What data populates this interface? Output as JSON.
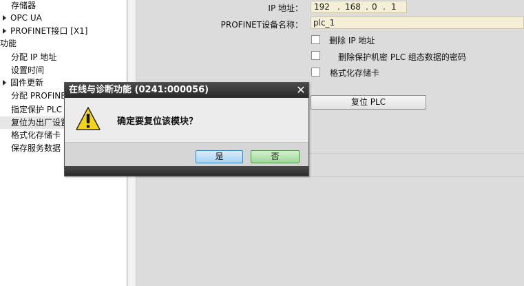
{
  "nav": {
    "items": [
      {
        "label": "存储器"
      },
      {
        "label": "OPC UA"
      },
      {
        "label": "PROFINET接口 [X1]"
      },
      {
        "label": "功能"
      },
      {
        "label": "分配 IP 地址"
      },
      {
        "label": "设置时间"
      },
      {
        "label": "固件更新"
      },
      {
        "label": "分配 PROFINET"
      },
      {
        "label": "指定保护 PLC 组"
      },
      {
        "label": "复位为出厂设置"
      },
      {
        "label": "格式化存储卡"
      },
      {
        "label": "保存服务数据"
      }
    ]
  },
  "form": {
    "ip_label": "IP 地址：",
    "ip_octets": [
      "192",
      ".",
      "168",
      ".",
      "0",
      ".",
      "1"
    ],
    "name_label": "PROFINET设备名称：",
    "name_value": "plc_1",
    "options": [
      {
        "label": "删除 IP 地址",
        "checked": false
      },
      {
        "label": "删除保护机密 PLC 组态数据的密码",
        "checked": false
      },
      {
        "label": "格式化存储卡",
        "checked": false
      }
    ],
    "reset_button": "复位 PLC"
  },
  "dialog": {
    "title": "在线与诊断功能 (0241:000056)",
    "close_glyph": "✕",
    "message": "确定要复位该模块？",
    "icon": "warning-icon",
    "yes_label": "是",
    "no_label": "否"
  },
  "colors": {
    "dialog_title_bg": "#333333",
    "yes_button": "#aed6f1",
    "no_button": "#a6dc9f",
    "input_bg": "#f6efd8"
  }
}
